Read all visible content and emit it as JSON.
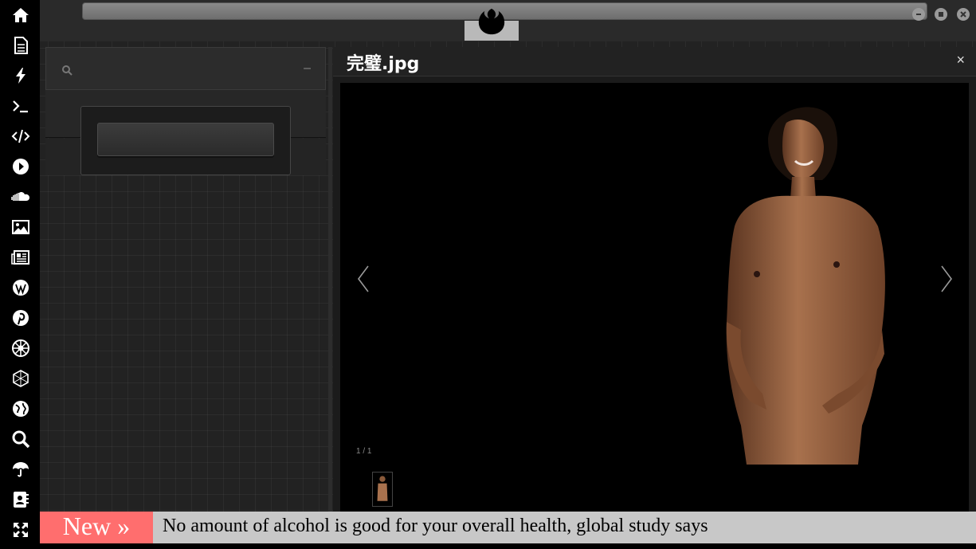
{
  "sidebar": {
    "icons": [
      "home-icon",
      "document-icon",
      "bolt-icon",
      "terminal-icon",
      "code-icon",
      "play-icon",
      "soundcloud-icon",
      "image-icon",
      "news-icon",
      "wordpress-icon",
      "pinterest-icon",
      "empire-icon",
      "hexagon-icon",
      "globe-icon",
      "search-icon",
      "umbrella-icon",
      "contacts-icon",
      "expand-icon"
    ]
  },
  "viewer": {
    "title": "完璧.jpg",
    "close_label": "×",
    "counter": "1 / 1"
  },
  "panel": {
    "minimize_label": "–"
  },
  "ticker": {
    "badge": "New »",
    "headline": "No amount of alcohol is good for your overall health, global study says"
  },
  "colors": {
    "ticker_badge": "#ff6e6e",
    "ticker_bg": "#c8c8c8",
    "sidebar_bg": "#000000"
  }
}
